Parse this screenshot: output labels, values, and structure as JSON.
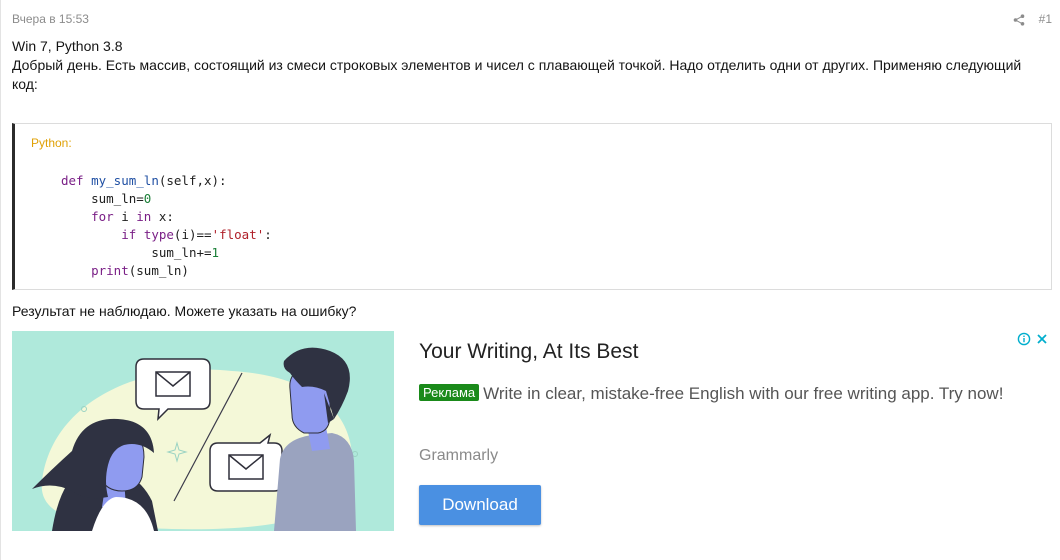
{
  "post": {
    "date": "Вчера в 15:53",
    "number": "#1",
    "lines": [
      "Win 7, Python 3.8",
      "Добрый день. Есть массив, состоящий из смеси строковых элементов и чисел с плавающей точкой. Надо отделить одни от других. Применяю следующий",
      "код:"
    ],
    "result": "Результат не наблюдаю. Можете указать на ошибку?"
  },
  "code": {
    "language": "Python:",
    "tokens": {
      "def": "def",
      "fn_name": "my_sum_ln",
      "params": "(self,x):",
      "var_init": "sum_ln=",
      "zero": "0",
      "for": "for",
      "loop_var": " i ",
      "in": "in",
      "iterable": " x:",
      "if": "if",
      "type": "type",
      "type_arg": "(i)==",
      "float_str": "'float'",
      "colon": ":",
      "increment": "sum_ln+=",
      "one": "1",
      "print": "print",
      "print_arg": "(sum_ln)"
    }
  },
  "ad": {
    "title": "Your Writing, At Its Best",
    "badge": "Реклама",
    "text": "Write in clear, mistake-free English with our free writing app. Try now!",
    "advertiser": "Grammarly",
    "button": "Download"
  },
  "colors": {
    "accent": "#4a90e2",
    "badge": "#1a8a1a",
    "code_lang": "#e0a106",
    "ad_bg": "#afe9db"
  },
  "icons": {
    "share": "share-icon",
    "info": "info-icon",
    "close": "close-icon",
    "envelope": "envelope-icon"
  }
}
